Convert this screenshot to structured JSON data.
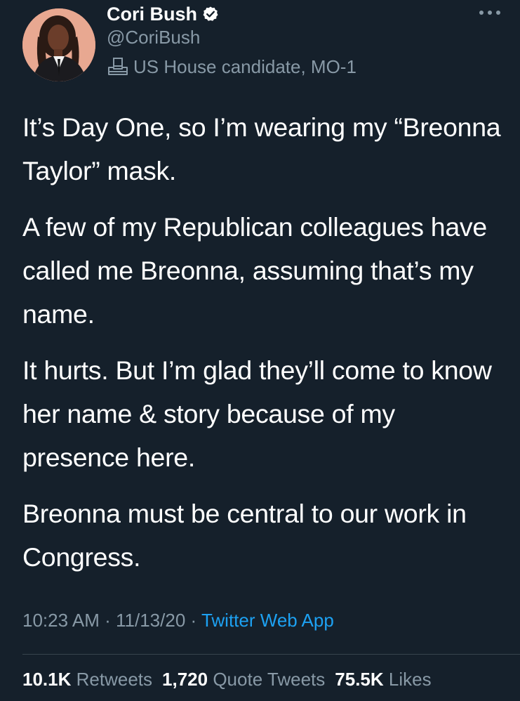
{
  "author": {
    "display_name": "Cori Bush",
    "handle": "@CoriBush",
    "verified_icon": "verified-badge-icon",
    "label_icon": "ballot-box-icon",
    "label": "US House candidate, MO-1"
  },
  "tweet": {
    "paragraphs": [
      "It’s Day One, so I’m wearing my “Breonna Taylor” mask.",
      "A few of my Republican colleagues have called me Breonna, assuming that’s my name.",
      "It hurts. But I’m glad they’ll come to know her name & story because of my presence here.",
      "Breonna must be central to our work in Congress."
    ],
    "time": "10:23 AM",
    "date": "11/13/20",
    "separator": "·",
    "source": "Twitter Web App"
  },
  "stats": {
    "retweets_count": "10.1K",
    "retweets_label": "Retweets",
    "quotes_count": "1,720",
    "quotes_label": "Quote Tweets",
    "likes_count": "75.5K",
    "likes_label": "Likes"
  },
  "colors": {
    "background": "#15202b",
    "secondary_text": "#8899a6",
    "accent": "#1da1f2",
    "divider": "#38444d"
  }
}
